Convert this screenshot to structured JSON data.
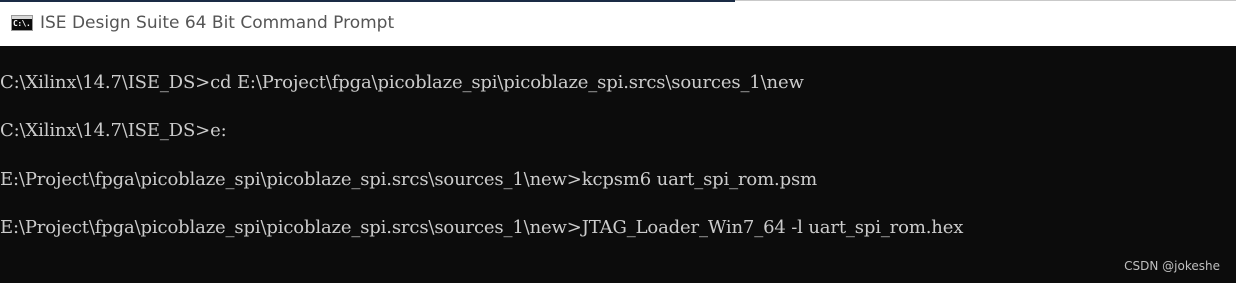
{
  "window": {
    "title": "ISE Design Suite 64 Bit Command Prompt",
    "icon": "cmd-icon",
    "icon_label": "C:\\."
  },
  "console": {
    "lines": [
      "C:\\Xilinx\\14.7\\ISE_DS>cd E:\\Project\\fpga\\picoblaze_spi\\picoblaze_spi.srcs\\sources_1\\new",
      "C:\\Xilinx\\14.7\\ISE_DS>e:",
      "E:\\Project\\fpga\\picoblaze_spi\\picoblaze_spi.srcs\\sources_1\\new>kcpsm6 uart_spi_rom.psm",
      "E:\\Project\\fpga\\picoblaze_spi\\picoblaze_spi.srcs\\sources_1\\new>JTAG_Loader_Win7_64 -l uart_spi_rom.hex"
    ]
  },
  "watermark": "CSDN @jokeshe"
}
